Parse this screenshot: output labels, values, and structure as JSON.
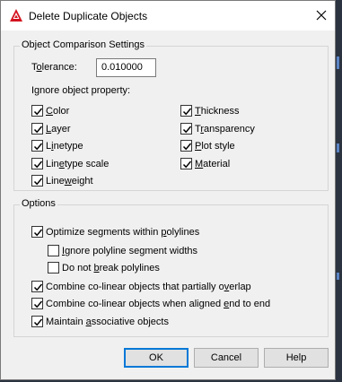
{
  "dialog": {
    "title": "Delete Duplicate Objects",
    "icon": "autocad-logo-icon",
    "close_icon": "close-icon"
  },
  "comparison": {
    "group_title": "Object Comparison Settings",
    "tolerance": {
      "label_pre": "T",
      "label_u": "o",
      "label_post": "lerance:",
      "value": "0.010000"
    },
    "ignore_label": "Ignore object property:",
    "left_properties": [
      {
        "pre": "",
        "u": "C",
        "post": "olor",
        "checked": true
      },
      {
        "pre": "",
        "u": "L",
        "post": "ayer",
        "checked": true
      },
      {
        "pre": "L",
        "u": "i",
        "post": "netype",
        "checked": true
      },
      {
        "pre": "Lin",
        "u": "e",
        "post": "type scale",
        "checked": true
      },
      {
        "pre": "Line",
        "u": "w",
        "post": "eight",
        "checked": true
      }
    ],
    "right_properties": [
      {
        "pre": "",
        "u": "T",
        "post": "hickness",
        "checked": true
      },
      {
        "pre": "T",
        "u": "r",
        "post": "ansparency",
        "checked": true
      },
      {
        "pre": "",
        "u": "P",
        "post": "lot style",
        "checked": true
      },
      {
        "pre": "",
        "u": "M",
        "post": "aterial",
        "checked": true
      }
    ]
  },
  "options": {
    "group_title": "Options",
    "optimize": {
      "pre": "Optimize segments within ",
      "u": "p",
      "post": "olylines",
      "checked": true
    },
    "ignore_widths": {
      "pre": "",
      "u": "I",
      "post": "gnore polyline segment widths",
      "checked": false
    },
    "no_break": {
      "pre": "Do not ",
      "u": "b",
      "post": "reak polylines",
      "checked": false
    },
    "partial_overlap": {
      "pre": "Combine co-linear objects that partially o",
      "u": "v",
      "post": "erlap",
      "checked": true
    },
    "end_to_end": {
      "pre": "Combine co-linear objects when aligned ",
      "u": "e",
      "post": "nd to end",
      "checked": true
    },
    "associative": {
      "pre": "Maintain ",
      "u": "a",
      "post": "ssociative objects",
      "checked": true
    }
  },
  "buttons": {
    "ok": "OK",
    "cancel": "Cancel",
    "help": "Help"
  }
}
